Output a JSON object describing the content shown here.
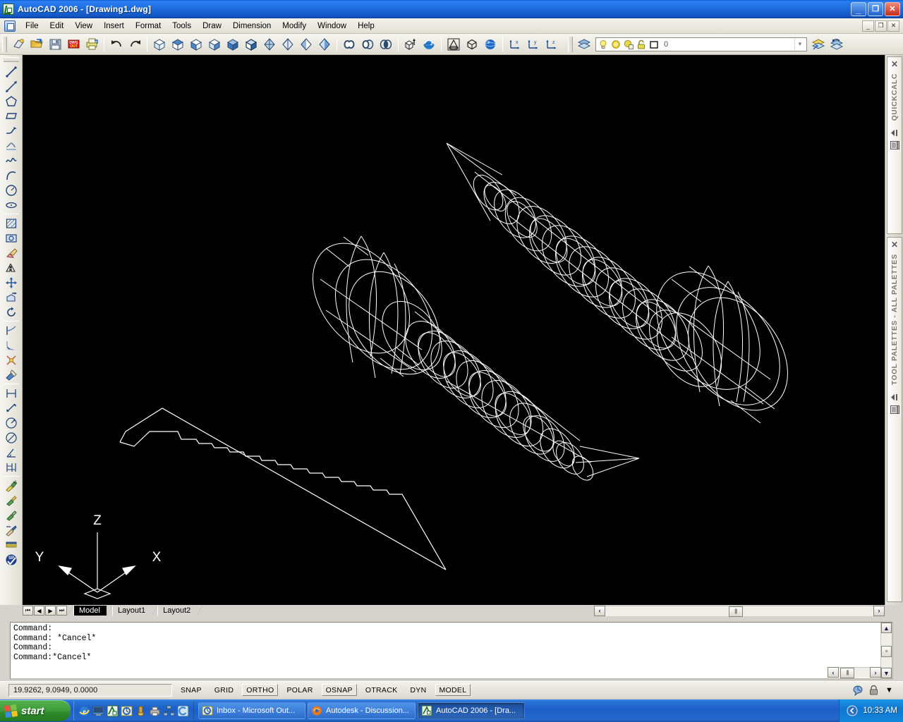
{
  "window": {
    "title": "AutoCAD 2006 - [Drawing1.dwg]",
    "app_icon": "autocad-icon",
    "minimize_label": "_",
    "maximize_label": "❐",
    "close_label": "✕",
    "mdi_minimize_label": "_",
    "mdi_restore_label": "❐",
    "mdi_close_label": "✕"
  },
  "menu": {
    "items": [
      {
        "label": "File"
      },
      {
        "label": "Edit"
      },
      {
        "label": "View"
      },
      {
        "label": "Insert"
      },
      {
        "label": "Format"
      },
      {
        "label": "Tools"
      },
      {
        "label": "Draw"
      },
      {
        "label": "Dimension"
      },
      {
        "label": "Modify"
      },
      {
        "label": "Window"
      },
      {
        "label": "Help"
      }
    ]
  },
  "toolbar_top": {
    "groups": [
      {
        "name": "standard",
        "buttons": [
          {
            "icon": "qnew-icon",
            "tooltip": "QNew"
          },
          {
            "icon": "open-icon",
            "tooltip": "Open"
          },
          {
            "icon": "save-icon",
            "tooltip": "Save"
          },
          {
            "icon": "plot-dwf-icon",
            "tooltip": "Publish to Web / DWF Out"
          },
          {
            "icon": "plot-icon",
            "tooltip": "Plot"
          }
        ]
      },
      {
        "name": "undo-redo",
        "buttons": [
          {
            "icon": "undo-icon",
            "tooltip": "Undo"
          },
          {
            "icon": "redo-icon",
            "tooltip": "Redo"
          }
        ]
      },
      {
        "name": "view-3d",
        "buttons": [
          {
            "icon": "view-sw-isometric-icon",
            "tooltip": "SW Isometric View"
          },
          {
            "icon": "view-se-isometric-icon",
            "tooltip": "SE Isometric View"
          },
          {
            "icon": "view-ne-isometric-icon",
            "tooltip": "NE Isometric View"
          },
          {
            "icon": "view-nw-isometric-icon",
            "tooltip": "NW Isometric View"
          },
          {
            "icon": "view-shaded-icon",
            "tooltip": "Shaded View"
          },
          {
            "icon": "view-shaded-edges-icon",
            "tooltip": "Shaded with Edges"
          },
          {
            "icon": "shade-flat-icon",
            "tooltip": "Flat Shaded"
          },
          {
            "icon": "shade-gouraud-icon",
            "tooltip": "Gouraud Shaded"
          },
          {
            "icon": "shade-flat-edges-icon",
            "tooltip": "Flat Shaded Edges On"
          },
          {
            "icon": "shade-gouraud-edges-icon",
            "tooltip": "Gouraud Shaded Edges On"
          }
        ]
      },
      {
        "name": "boolean",
        "buttons": [
          {
            "icon": "union-icon",
            "tooltip": "Union"
          },
          {
            "icon": "subtract-icon",
            "tooltip": "Subtract"
          },
          {
            "icon": "intersect-icon",
            "tooltip": "Intersect"
          }
        ]
      },
      {
        "name": "solids-edit",
        "buttons": [
          {
            "icon": "extrude-icon",
            "tooltip": "Extrude"
          },
          {
            "icon": "revolve-icon",
            "tooltip": "Revolve"
          }
        ]
      },
      {
        "name": "primitives",
        "buttons": [
          {
            "icon": "cone-icon",
            "tooltip": "Cone"
          },
          {
            "icon": "box-icon",
            "tooltip": "Box"
          },
          {
            "icon": "sphere-icon",
            "tooltip": "Sphere"
          }
        ]
      },
      {
        "name": "ucs-axis",
        "buttons": [
          {
            "icon": "ucs-x-icon",
            "tooltip": "X Axis Rotate UCS"
          },
          {
            "icon": "ucs-y-icon",
            "tooltip": "Y Axis Rotate UCS"
          },
          {
            "icon": "ucs-z-icon",
            "tooltip": "Z Axis Rotate UCS"
          }
        ]
      }
    ]
  },
  "layer_toolbar": {
    "layer_properties_icon": "layers-icon",
    "state_icons": [
      "lightbulb-on-icon",
      "sun-freeze-icon",
      "freeze-viewport-icon",
      "lock-icon",
      "color-swatch-icon"
    ],
    "current_layer": "0",
    "dropdown_icon": "chevron-down-icon",
    "make_layer_current_icon": "make-current-icon",
    "layer_previous_icon": "layer-previous-icon"
  },
  "toolbar_left": {
    "draw_buttons": [
      {
        "icon": "line-icon",
        "tooltip": "Line"
      },
      {
        "icon": "construction-line-icon",
        "tooltip": "Construction Line"
      },
      {
        "icon": "polygon-icon",
        "tooltip": "Polygon"
      },
      {
        "icon": "rectangle-icon",
        "tooltip": "Rectangle"
      },
      {
        "icon": "polyline-icon",
        "tooltip": "Polyline"
      },
      {
        "icon": "revision-cloud-icon",
        "tooltip": "Revision Cloud"
      },
      {
        "icon": "spline-icon",
        "tooltip": "Spline"
      },
      {
        "icon": "arc-icon",
        "tooltip": "Arc"
      },
      {
        "icon": "circle-icon",
        "tooltip": "Circle"
      },
      {
        "icon": "ellipse-icon",
        "tooltip": "Ellipse"
      },
      {
        "icon": "hatch-icon",
        "tooltip": "Hatch"
      },
      {
        "icon": "insert-block-icon",
        "tooltip": "Insert Block"
      },
      {
        "icon": "erase-icon",
        "tooltip": "Erase"
      },
      {
        "icon": "mirror-icon",
        "tooltip": "Mirror"
      },
      {
        "icon": "move-icon",
        "tooltip": "Move"
      },
      {
        "icon": "stretch-icon",
        "tooltip": "Stretch"
      },
      {
        "icon": "rotate-icon",
        "tooltip": "Rotate"
      },
      {
        "icon": "trim-icon",
        "tooltip": "Trim"
      },
      {
        "icon": "fillet-icon",
        "tooltip": "Fillet"
      },
      {
        "icon": "explode-icon",
        "tooltip": "Explode"
      },
      {
        "icon": "match-properties-icon",
        "tooltip": "Match Properties"
      },
      {
        "icon": "linear-dimension-icon",
        "tooltip": "Linear Dimension"
      },
      {
        "icon": "aligned-dimension-icon",
        "tooltip": "Aligned Dimension"
      },
      {
        "icon": "radius-dimension-icon",
        "tooltip": "Radius Dimension"
      },
      {
        "icon": "diameter-dimension-icon",
        "tooltip": "Diameter Dimension"
      },
      {
        "icon": "angular-dimension-icon",
        "tooltip": "Angular Dimension"
      },
      {
        "icon": "baseline-dimension-icon",
        "tooltip": "Baseline Dimension"
      },
      {
        "icon": "multiline-text-icon",
        "tooltip": "Multiline Text"
      },
      {
        "icon": "edit-text-icon",
        "tooltip": "Edit Text"
      },
      {
        "icon": "edit-hatch-icon",
        "tooltip": "Edit Hatch"
      },
      {
        "icon": "dimension-style-icon",
        "tooltip": "Dimension Style"
      },
      {
        "icon": "tool-palettes-icon",
        "tooltip": "Tool Palettes"
      },
      {
        "icon": "spell-check-icon",
        "tooltip": "Spelling"
      }
    ]
  },
  "palettes": [
    {
      "label": "QUICKCALC",
      "close_icon": "close-icon",
      "autohide_icon": "autohide-icon",
      "menu_icon": "palette-menu-icon"
    },
    {
      "label": "TOOL PALETTES - ALL PALETTES",
      "close_icon": "close-icon",
      "autohide_icon": "autohide-icon",
      "menu_icon": "palette-menu-icon"
    }
  ],
  "layout_tabs": {
    "nav": [
      {
        "icon": "first-tab-icon",
        "label": "⏮"
      },
      {
        "icon": "prev-tab-icon",
        "label": "◀"
      },
      {
        "icon": "next-tab-icon",
        "label": "▶"
      },
      {
        "icon": "last-tab-icon",
        "label": "⏭"
      }
    ],
    "tabs": [
      {
        "label": "Model",
        "active": true
      },
      {
        "label": "Layout1",
        "active": false
      },
      {
        "label": "Layout2",
        "active": false
      }
    ],
    "scroll_left_icon": "scroll-left-icon",
    "scroll_right_icon": "scroll-right-icon",
    "scroll_left_label": "‹",
    "scroll_right_label": "›"
  },
  "command_window": {
    "lines": [
      "Command:",
      "Command: *Cancel*",
      "Command:",
      "Command:*Cancel*"
    ],
    "scroll_up_label": "▲",
    "scroll_down_label": "▼",
    "scroll_left_label": "‹",
    "scroll_right_label": "›"
  },
  "status_bar": {
    "coordinates": "19.9262, 9.0949, 0.0000",
    "toggles": [
      {
        "label": "SNAP",
        "on": false
      },
      {
        "label": "GRID",
        "on": false
      },
      {
        "label": "ORTHO",
        "on": true
      },
      {
        "label": "POLAR",
        "on": false
      },
      {
        "label": "OSNAP",
        "on": true
      },
      {
        "label": "OTRACK",
        "on": false
      },
      {
        "label": "DYN",
        "on": false
      },
      {
        "label": "MODEL",
        "on": true
      }
    ],
    "tray_icons": [
      "communication-center-icon",
      "lock-toolbars-icon",
      "tray-menu-icon"
    ],
    "tray_menu_label": "▼"
  },
  "drawing": {
    "ucs_icon": {
      "x_label": "X",
      "y_label": "Y",
      "z_label": "Z"
    },
    "objects": [
      {
        "name": "screw-lower-left",
        "type": "3d-wireframe-screw"
      },
      {
        "name": "screw-upper-right",
        "type": "3d-wireframe-screw"
      },
      {
        "name": "thread-profile-polyline",
        "type": "2d-polyline"
      }
    ],
    "background_color": "#000000",
    "line_color": "#ffffff"
  },
  "taskbar": {
    "start_label": "start",
    "quick_launch": [
      {
        "icon": "ie-icon"
      },
      {
        "icon": "show-desktop-icon"
      },
      {
        "icon": "autocad-icon"
      },
      {
        "icon": "outlook-icon"
      },
      {
        "icon": "media-icon"
      },
      {
        "icon": "printer-icon"
      },
      {
        "icon": "network-icon"
      },
      {
        "icon": "groove-icon"
      }
    ],
    "tasks": [
      {
        "label": "Inbox - Microsoft Out...",
        "icon": "outlook-icon",
        "active": false
      },
      {
        "label": "Autodesk - Discussion...",
        "icon": "firefox-icon",
        "active": false
      },
      {
        "label": "AutoCAD 2006 - [Dra...",
        "icon": "autocad-icon",
        "active": true
      }
    ],
    "tray": {
      "expand_icon": "tray-expand-icon",
      "expand_label": "‹",
      "clock": "10:33 AM"
    }
  },
  "colors": {
    "title_blue": "#1f6fe0",
    "chrome": "#d6d3ce",
    "canvas": "#000000",
    "taskbar_blue": "#2569cc",
    "start_green": "#41a03b"
  }
}
